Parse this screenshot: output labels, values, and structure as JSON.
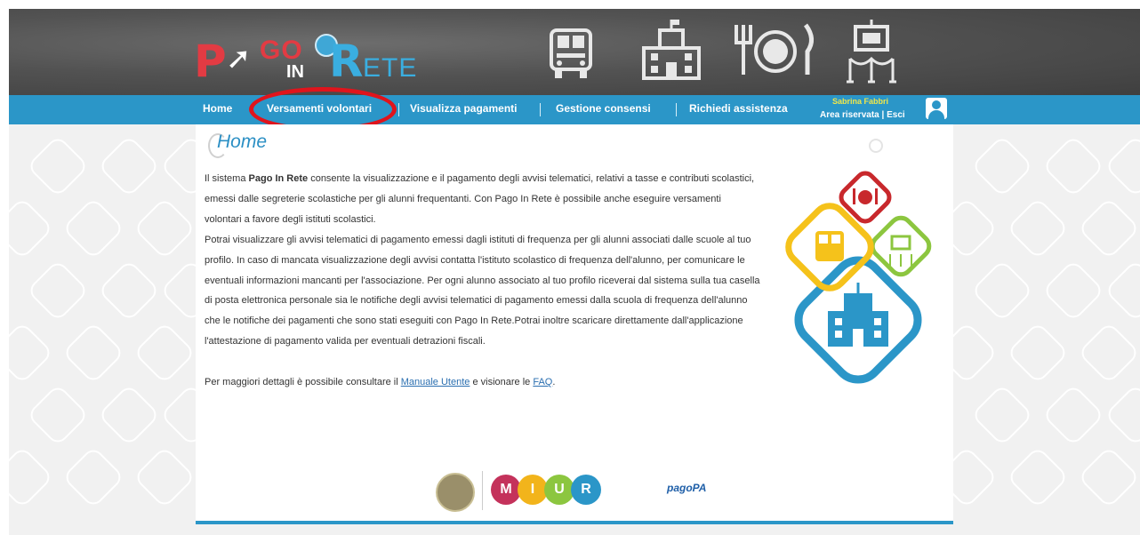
{
  "logo": {
    "p": "P",
    "go": "GO",
    "in": "IN",
    "r": "R",
    "ete": "ETE"
  },
  "header_icons": [
    "school-bus-icon",
    "school-building-icon",
    "meal-icon",
    "museum-trip-icon"
  ],
  "nav": {
    "home": "Home",
    "versamenti": "Versamenti volontari",
    "visualizza": "Visualizza pagamenti",
    "gestione": "Gestione consensi",
    "assistenza": "Richiedi assistenza"
  },
  "user": {
    "name": "Sabrina Fabbri",
    "area": "Area riservata",
    "separator": "|",
    "logout": "Esci"
  },
  "main": {
    "title": "Home",
    "intro_1": "Il sistema ",
    "intro_brand": "Pago In Rete",
    "intro_2": " consente la visualizzazione e il pagamento degli avvisi telematici, relativi a tasse e contributi scolastici, emessi dalle segreterie scolastiche per gli alunni frequentanti. Con Pago In Rete è possibile anche eseguire versamenti volontari a favore degli istituti scolastici.",
    "para_2": "Potrai visualizzare gli avvisi telematici di pagamento emessi dagli istituti di frequenza per gli alunni associati dalle scuole al tuo profilo. In caso di mancata visualizzazione degli avvisi contatta l'istituto scolastico di frequenza dell'alunno, per comunicare le eventuali informazioni mancanti per l'associazione. Per ogni alunno associato al tuo profilo riceverai dal sistema sulla tua casella di posta elettronica personale sia le notifiche degli avvisi telematici di pagamento emessi dalla scuola di frequenza dell'alunno che le notifiche dei pagamenti che sono stati eseguiti con Pago In Rete.Potrai inoltre scaricare direttamente dall'applicazione l'attestazione di pagamento valida per eventuali detrazioni fiscali.",
    "more_1": "Per maggiori dettagli è possibile consultare il ",
    "manual_link": "Manuale Utente",
    "more_2": " e visionare le ",
    "faq_link": "FAQ",
    "more_3": "."
  },
  "footer": {
    "miur_letters": [
      "M",
      "I",
      "U",
      "R"
    ],
    "pagopa": "pagoPA"
  },
  "colors": {
    "nav_blue": "#2b96c8",
    "highlight_red": "#e0141c",
    "title_blue": "#2b8fc4",
    "user_yellow": "#f0e64a"
  }
}
